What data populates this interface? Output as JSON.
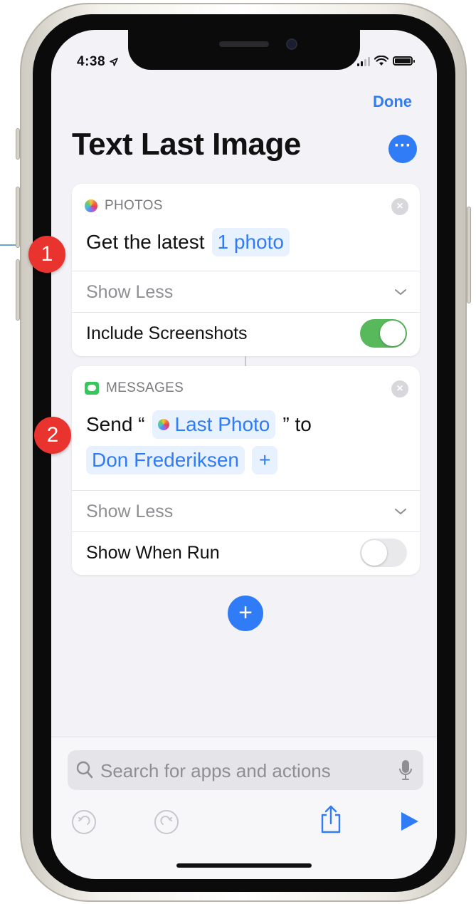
{
  "status_bar": {
    "time": "4:38"
  },
  "nav": {
    "done_label": "Done"
  },
  "page": {
    "title": "Text Last Image"
  },
  "photos_action": {
    "app_name": "PHOTOS",
    "text_prefix": "Get the latest",
    "count_token": "1 photo",
    "show_less_label": "Show Less",
    "include_screenshots_label": "Include Screenshots",
    "include_screenshots_on": true
  },
  "messages_action": {
    "app_name": "MESSAGES",
    "send_prefix": "Send “",
    "message_token": "Last Photo",
    "send_suffix": "” to",
    "recipient_token": "Don Frederiksen",
    "add_recipient_symbol": "+",
    "show_less_label": "Show Less",
    "show_when_run_label": "Show When Run",
    "show_when_run_on": false
  },
  "annotations": {
    "badge_1": "1",
    "badge_2": "2"
  },
  "search": {
    "placeholder": "Search for apps and actions"
  },
  "colors": {
    "accent": "#2f7cf6",
    "toggle_on": "#58b85c",
    "badge": "#e8332f",
    "token_bg": "#e8f1fe"
  },
  "icons": {
    "more": "ellipsis-icon",
    "close": "close-icon",
    "chevron": "chevron-down-icon",
    "add": "plus-icon",
    "search": "search-icon",
    "mic": "microphone-icon",
    "undo": "undo-icon",
    "redo": "redo-icon",
    "share": "share-icon",
    "play": "play-icon"
  }
}
